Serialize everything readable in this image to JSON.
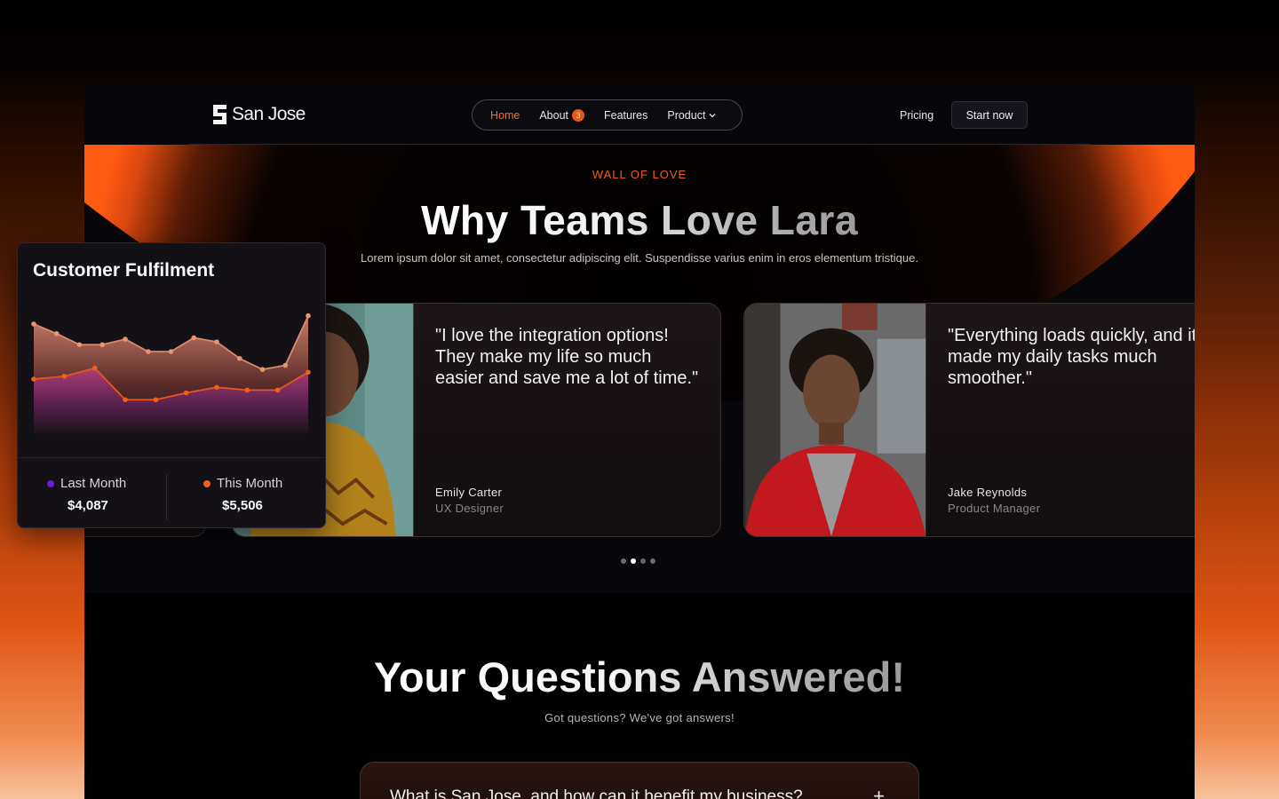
{
  "nav": {
    "brand": "San Jose",
    "items": [
      {
        "label": "Home"
      },
      {
        "label": "About",
        "badge": "3"
      },
      {
        "label": "Features"
      },
      {
        "label": "Product"
      }
    ],
    "pricing": "Pricing",
    "cta": "Start now"
  },
  "hero": {
    "eyebrow": "WALL OF LOVE",
    "title": "Why Teams Love Lara",
    "subtitle": "Lorem ipsum dolor sit amet, consectetur adipiscing elit. Suspendisse varius enim in eros elementum tristique."
  },
  "testimonials": [
    {
      "quote": "\"I love the integration options! They make my life so much easier and save me a lot of time.\"",
      "name": "Emily Carter",
      "role": "UX Designer"
    },
    {
      "quote": "\"Everything loads quickly, and it made my daily tasks much smoother.\"",
      "name": "Jake Reynolds",
      "role": "Product Manager"
    }
  ],
  "carousel": {
    "total": 4,
    "active": 1
  },
  "faq": {
    "title": "Your Questions Answered!",
    "subtitle": "Got questions? We've got answers!",
    "items": [
      {
        "question": "What is San Jose, and how can it benefit my business?"
      }
    ]
  },
  "widget": {
    "title": "Customer Fulfilment",
    "legend": [
      {
        "label": "Last Month",
        "value": "$4,087",
        "color": "#6a1fd6"
      },
      {
        "label": "This Month",
        "value": "$5,506",
        "color": "#f0601c"
      }
    ]
  },
  "chart_data": {
    "type": "area",
    "title": "Customer Fulfilment",
    "x": [
      0,
      1,
      2,
      3,
      4,
      5,
      6,
      7,
      8,
      9,
      10,
      11,
      12,
      13,
      14
    ],
    "series": [
      {
        "name": "Last Month",
        "values": [
          80,
          73,
          65,
          65,
          69,
          60,
          60,
          70,
          67,
          55,
          47,
          50,
          86,
          null,
          null
        ]
      },
      {
        "name": "This Month",
        "values": [
          40,
          42,
          48,
          25,
          25,
          30,
          34,
          32,
          32,
          45,
          null,
          null,
          null,
          null,
          null
        ]
      }
    ],
    "ylim": [
      0,
      100
    ],
    "grid": false
  }
}
